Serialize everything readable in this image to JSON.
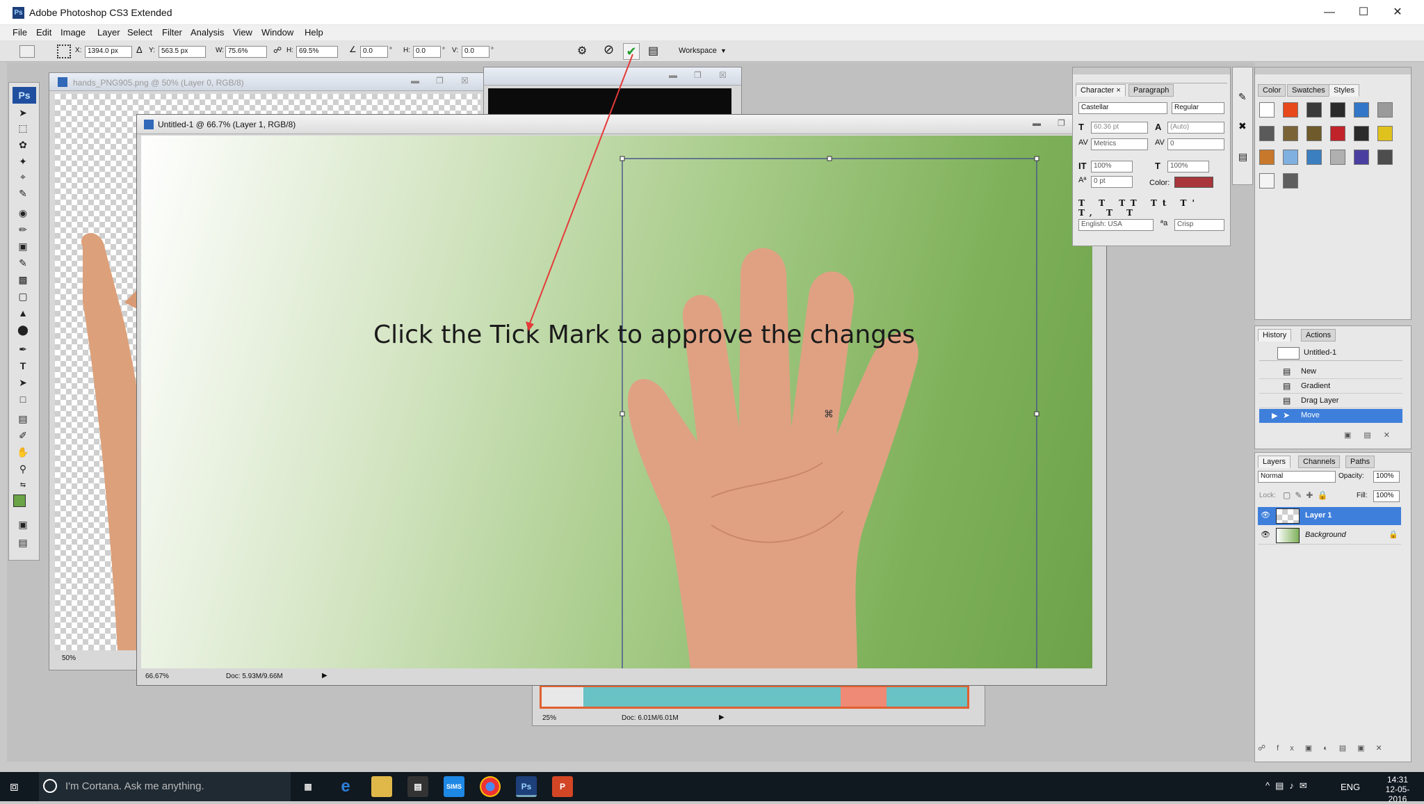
{
  "app": {
    "title": "Adobe Photoshop CS3 Extended"
  },
  "menu": [
    "File",
    "Edit",
    "Image",
    "Layer",
    "Select",
    "Filter",
    "Analysis",
    "View",
    "Window",
    "Help"
  ],
  "options": {
    "x_label": "X:",
    "x": "1394.0 px",
    "y_label": "Y:",
    "y": "563.5 px",
    "w_label": "W:",
    "w": "75.6%",
    "h_label": "H:",
    "h": "69.5%",
    "angle": "0.0",
    "hskew_label": "H:",
    "hskew": "0.0",
    "vskew_label": "V:",
    "vskew": "0.0",
    "workspace": "Workspace"
  },
  "doc_back": {
    "title": "hands_PNG905.png @ 50% (Layer 0, RGB/8)",
    "zoom": "50%"
  },
  "doc_main": {
    "title": "Untitled-1 @ 66.7% (Layer 1, RGB/8)",
    "zoom": "66.67%",
    "docinfo": "Doc: 5.93M/9.66M"
  },
  "doc_map": {
    "zoom": "25%",
    "docinfo": "Doc: 6.01M/6.01M"
  },
  "annotation": "Click the Tick Mark to approve the changes",
  "character": {
    "tab1": "Character",
    "tab2": "Paragraph",
    "font": "Castellar",
    "style": "Regular",
    "size": "60.36 pt",
    "leading": "(Auto)",
    "kerning": "Metrics",
    "tracking": "0",
    "vscale": "100%",
    "hscale": "100%",
    "baseline": "0 pt",
    "color_label": "Color:",
    "language": "English: USA",
    "aa": "Crisp",
    "color": "#a8363b"
  },
  "swatches": {
    "tabs": [
      "Color",
      "Swatches",
      "Styles"
    ],
    "colors": [
      "#ffffff",
      "#e8491c",
      "#3a3a3a",
      "#2a2a2a",
      "#3277c7",
      "#9a9a9a",
      "#5a5a5a",
      "#7b6338",
      "#6e5a2b",
      "#c0232a",
      "#2a2a2a",
      "#e0c21e",
      "#c8782a",
      "#7fb0e0",
      "#3c7fc0",
      "#b0b0b0",
      "#4a3fa0",
      "#4d4d4d",
      "#f4f4f4",
      "#5f5f5f"
    ]
  },
  "history": {
    "tabs": [
      "History",
      "Actions"
    ],
    "snapshot": "Untitled-1",
    "items": [
      "New",
      "Gradient",
      "Drag Layer",
      "Move"
    ]
  },
  "layers": {
    "tabs": [
      "Layers",
      "Channels",
      "Paths"
    ],
    "blend": "Normal",
    "opacity_label": "Opacity:",
    "opacity": "100%",
    "lock_label": "Lock:",
    "fill_label": "Fill:",
    "fill": "100%",
    "items": [
      "Layer 1",
      "Background"
    ]
  },
  "taskbar": {
    "cortana": "I'm Cortana. Ask me anything.",
    "lang": "ENG",
    "time": "14:31",
    "date": "12-05-2016",
    "sims": "SIMS",
    "ps": "Ps",
    "pp": "P"
  }
}
